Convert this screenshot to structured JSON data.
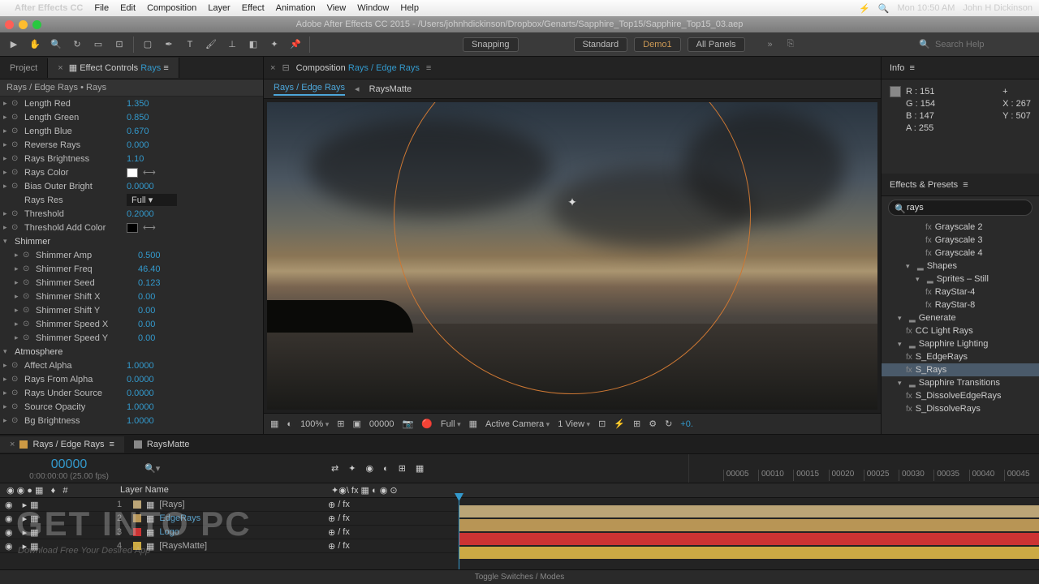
{
  "menubar": {
    "app": "After Effects CC",
    "items": [
      "File",
      "Edit",
      "Composition",
      "Layer",
      "Effect",
      "Animation",
      "View",
      "Window",
      "Help"
    ],
    "right": {
      "time": "Mon 10:50 AM",
      "user": "John H Dickinson"
    }
  },
  "titlebar": "Adobe After Effects CC 2015 - /Users/johnhdickinson/Dropbox/Genarts/Sapphire_Top15/Sapphire_Top15_03.aep",
  "toolbar": {
    "snapping": "Snapping",
    "standard": "Standard",
    "demo": "Demo1",
    "panels": "All Panels",
    "search_ph": "Search Help"
  },
  "tabs": {
    "project": "Project",
    "fx": "Effect Controls",
    "fx_layer": "Rays"
  },
  "fx_header": "Rays / Edge Rays • Rays",
  "fx": [
    {
      "t": "p",
      "label": "Length Red",
      "value": "1.350"
    },
    {
      "t": "p",
      "label": "Length Green",
      "value": "0.850"
    },
    {
      "t": "p",
      "label": "Length Blue",
      "value": "0.670"
    },
    {
      "t": "p",
      "label": "Reverse Rays",
      "value": "0.000"
    },
    {
      "t": "p",
      "label": "Rays Brightness",
      "value": "1.10"
    },
    {
      "t": "c",
      "label": "Rays Color",
      "color": "#ffffff"
    },
    {
      "t": "p",
      "label": "Bias Outer Bright",
      "value": "0.0000"
    },
    {
      "t": "d",
      "label": "Rays Res",
      "value": "Full"
    },
    {
      "t": "p",
      "label": "Threshold",
      "value": "0.2000"
    },
    {
      "t": "c",
      "label": "Threshold Add Color",
      "color": "#000000"
    },
    {
      "t": "g",
      "label": "Shimmer"
    },
    {
      "t": "p",
      "label": "Shimmer Amp",
      "value": "0.500",
      "indent": 1
    },
    {
      "t": "p",
      "label": "Shimmer Freq",
      "value": "46.40",
      "indent": 1
    },
    {
      "t": "p",
      "label": "Shimmer Seed",
      "value": "0.123",
      "indent": 1
    },
    {
      "t": "p",
      "label": "Shimmer Shift X",
      "value": "0.00",
      "indent": 1
    },
    {
      "t": "p",
      "label": "Shimmer Shift Y",
      "value": "0.00",
      "indent": 1
    },
    {
      "t": "p",
      "label": "Shimmer Speed X",
      "value": "0.00",
      "indent": 1
    },
    {
      "t": "p",
      "label": "Shimmer Speed Y",
      "value": "0.00",
      "indent": 1
    },
    {
      "t": "g",
      "label": "Atmosphere"
    },
    {
      "t": "p",
      "label": "Affect Alpha",
      "value": "1.0000"
    },
    {
      "t": "p",
      "label": "Rays From Alpha",
      "value": "0.0000"
    },
    {
      "t": "p",
      "label": "Rays Under Source",
      "value": "0.0000"
    },
    {
      "t": "p",
      "label": "Source Opacity",
      "value": "1.0000"
    },
    {
      "t": "p",
      "label": "Bg Brightness",
      "value": "1.0000"
    }
  ],
  "comp": {
    "title": "Composition",
    "path": "Rays / Edge Rays",
    "nav_active": "Rays / Edge Rays",
    "nav_other": "RaysMatte"
  },
  "viewerbar": {
    "zoom": "100%",
    "time": "00000",
    "res": "Full",
    "camera": "Active Camera",
    "view": "1 View",
    "exp": "+0."
  },
  "info": {
    "title": "Info",
    "r": "R : 151",
    "g": "G : 154",
    "b": "B : 147",
    "a": "A : 255",
    "x": "X : 267",
    "y": "Y : 507"
  },
  "presets": {
    "title": "Effects & Presets",
    "search": "rays",
    "items": [
      {
        "label": "Grayscale 2",
        "ind": 3,
        "ico": "fx"
      },
      {
        "label": "Grayscale 3",
        "ind": 3,
        "ico": "fx"
      },
      {
        "label": "Grayscale 4",
        "ind": 3,
        "ico": "fx"
      },
      {
        "label": "Shapes",
        "ind": 1,
        "folder": 1,
        "tri": "▾"
      },
      {
        "label": "Sprites – Still",
        "ind": 2,
        "folder": 1,
        "tri": "▾"
      },
      {
        "label": "RayStar-4",
        "ind": 3,
        "ico": "fx"
      },
      {
        "label": "RayStar-8",
        "ind": 3,
        "ico": "fx"
      },
      {
        "label": "Generate",
        "ind": 0,
        "folder": 1,
        "tri": "▾"
      },
      {
        "label": "CC Light Rays",
        "ind": 1,
        "ico": "fx"
      },
      {
        "label": "Sapphire Lighting",
        "ind": 0,
        "folder": 1,
        "tri": "▾"
      },
      {
        "label": "S_EdgeRays",
        "ind": 1,
        "ico": "fx"
      },
      {
        "label": "S_Rays",
        "ind": 1,
        "ico": "fx",
        "sel": 1
      },
      {
        "label": "Sapphire Transitions",
        "ind": 0,
        "folder": 1,
        "tri": "▾"
      },
      {
        "label": "S_DissolveEdgeRays",
        "ind": 1,
        "ico": "fx"
      },
      {
        "label": "S_DissolveRays",
        "ind": 1,
        "ico": "fx"
      }
    ]
  },
  "timeline": {
    "tab1": "Rays / Edge Rays",
    "tab2": "RaysMatte",
    "tc": "00000",
    "sub": "0:00:00:00 (25.00 fps)",
    "ticks": [
      "00005",
      "00010",
      "00015",
      "00020",
      "00025",
      "00030",
      "00035",
      "00040",
      "00045"
    ],
    "header": {
      "name": "Layer Name"
    },
    "layers": [
      {
        "num": "1",
        "name": "[Rays]",
        "color": "#bba577",
        "br": 1
      },
      {
        "num": "2",
        "name": "EdgeRays",
        "color": "#b89555"
      },
      {
        "num": "3",
        "name": "Logo",
        "color": "#cc3333"
      },
      {
        "num": "4",
        "name": "[RaysMatte]",
        "color": "#ccaa44",
        "br": 1
      }
    ],
    "footer": "Toggle Switches / Modes"
  },
  "watermark": {
    "main": "GET INTO PC",
    "sub": "Download Free Your Desired App"
  }
}
